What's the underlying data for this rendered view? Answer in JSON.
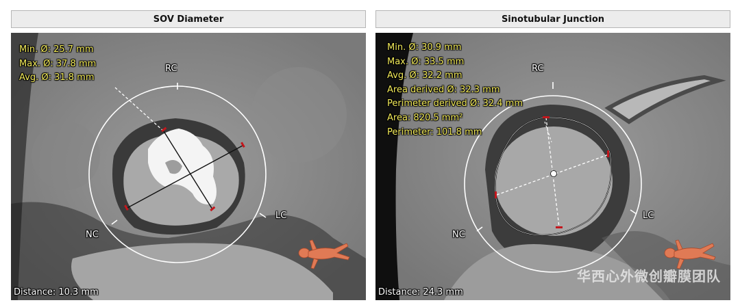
{
  "panels": [
    {
      "title": "SOV Diameter",
      "measurements": [
        "Min. Ø: 25.7 mm",
        "Max. Ø: 37.8 mm",
        "Avg. Ø: 31.8 mm"
      ],
      "orientation": {
        "top": "RC",
        "right": "LC",
        "left": "NC"
      },
      "distance": "Distance: 10.3 mm"
    },
    {
      "title": "Sinotubular Junction",
      "measurements": [
        "Min. Ø: 30.9 mm",
        "Max. Ø: 33.5 mm",
        "Avg. Ø: 32.2 mm",
        "Area derived Ø: 32.3 mm",
        "Perimeter derived Ø: 32.4 mm",
        "Area: 820.5 mm²",
        "Perimeter: 101.8 mm"
      ],
      "orientation": {
        "top": "RC",
        "right": "LC",
        "left": "NC"
      },
      "distance": "Distance: 24.3 mm",
      "watermark": "华西心外微创瓣膜团队"
    }
  ],
  "colors": {
    "overlay_text": "#f2ea5a",
    "measure_marker": "#c4161c",
    "header_bg": "#ececec",
    "body_icon": "#e07a55"
  },
  "icons": [
    "body-orientation-icon"
  ]
}
